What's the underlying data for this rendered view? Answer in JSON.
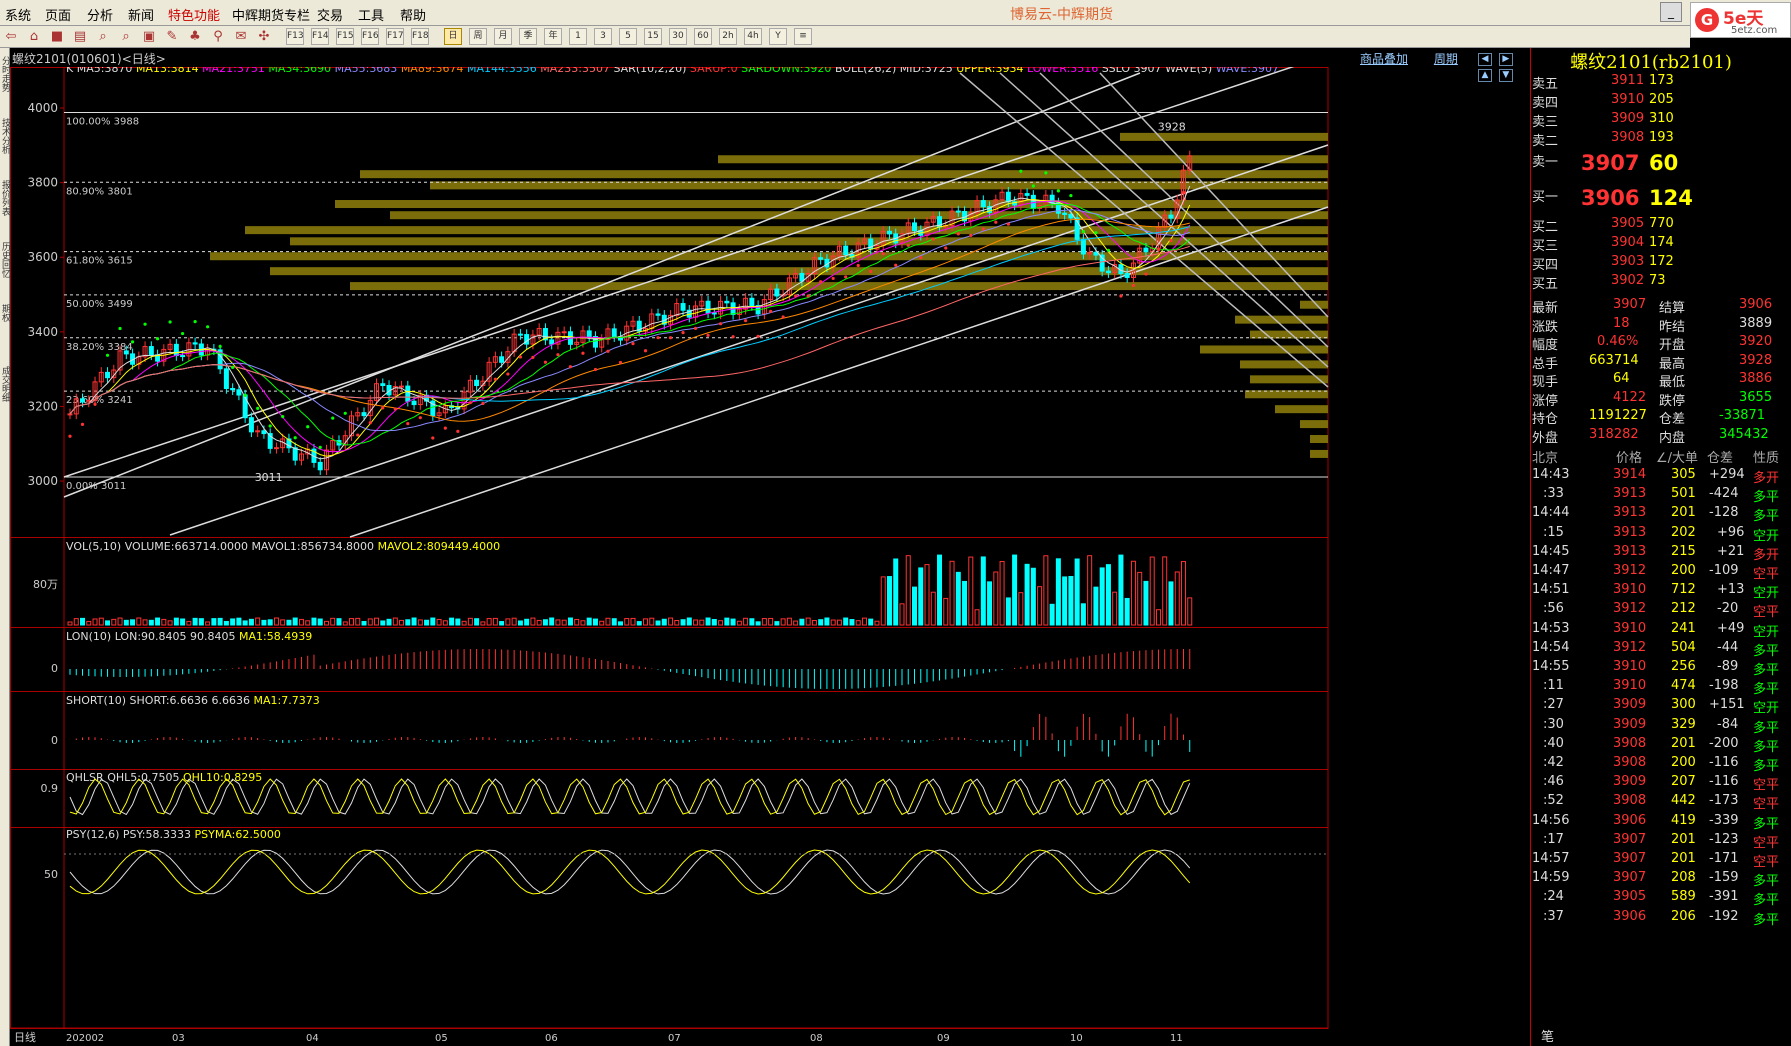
{
  "menu": [
    "系统",
    "页面",
    "分析",
    "新闻",
    "特色功能",
    "中辉期货专栏",
    "交易",
    "工具",
    "帮助"
  ],
  "app_title": "博易云-中辉期货",
  "logo": {
    "brand": "5e天",
    "site": "5etz.com"
  },
  "toolbar": [
    "F1",
    "F2",
    "F3",
    "F4",
    "F5",
    "F6",
    "F7",
    "F8",
    "F9",
    "F10",
    "F11",
    "F12",
    "F13",
    "F14",
    "F15",
    "F16",
    "F17",
    "F18",
    "日",
    "周",
    "月",
    "季",
    "年",
    "1",
    "3",
    "5",
    "15",
    "30",
    "60",
    "2h",
    "4h",
    "Y",
    "≡"
  ],
  "side_tabs": [
    "分时走势",
    "技术分析",
    "报价列表",
    "历史回忆",
    "期权",
    "成交明细"
  ],
  "chart_header": {
    "symbol": "螺纹2101(010601)<日线>",
    "links": [
      "商品叠加",
      "周期"
    ],
    "buttons": [
      "◀",
      "▶",
      "▲",
      "▼"
    ]
  },
  "main_panel": {
    "legend": [
      {
        "t": "K",
        "c": "#ddd"
      },
      {
        "t": "MA5:3870",
        "c": "#ddd"
      },
      {
        "t": "MA13:3814",
        "c": "#ff0"
      },
      {
        "t": "MA21:3751",
        "c": "#f0f"
      },
      {
        "t": "MA34:3690",
        "c": "#0f0"
      },
      {
        "t": "MA55:3683",
        "c": "#88f"
      },
      {
        "t": "MA89:3674",
        "c": "#f80"
      },
      {
        "t": "MA144:3556",
        "c": "#0cf"
      },
      {
        "t": "MA233:3507",
        "c": "#f66"
      },
      {
        "t": "SAR(10,2,20)",
        "c": "#ddd"
      },
      {
        "t": "SARUP:0",
        "c": "#f33"
      },
      {
        "t": "SARDOWN:3920",
        "c": "#0f0"
      },
      {
        "t": "BOLL(26,2)",
        "c": "#ddd"
      },
      {
        "t": "MID:3725",
        "c": "#ddd"
      },
      {
        "t": "UPPER:3934",
        "c": "#ff0"
      },
      {
        "t": "LOWER:3516",
        "c": "#f0f"
      },
      {
        "t": "SSLO",
        "c": "#ddd"
      },
      {
        "t": "3907",
        "c": "#ddd"
      },
      {
        "t": "WAVE(5)",
        "c": "#ddd"
      },
      {
        "t": "WAVE:3907",
        "c": "#88f"
      }
    ],
    "y_ticks": [
      4000,
      3800,
      3600,
      3400,
      3200,
      3000
    ],
    "fib": [
      {
        "label": "100.00% 3988",
        "v": 3988
      },
      {
        "label": "80.90% 3801",
        "v": 3801
      },
      {
        "label": "61.80% 3615",
        "v": 3615
      },
      {
        "label": "50.00% 3499",
        "v": 3499
      },
      {
        "label": "38.20% 3384",
        "v": 3384
      },
      {
        "label": "23.60% 3241",
        "v": 3241
      },
      {
        "label": "0.00% 3011",
        "v": 3011
      }
    ],
    "high_label": "3928",
    "low_label": "3011"
  },
  "vol_panel": {
    "legend": [
      {
        "t": "VOL(5,10) VOLUME:663714.0000",
        "c": "#ddd"
      },
      {
        "t": "MAVOL1:856734.8000",
        "c": "#ddd"
      },
      {
        "t": "MAVOL2:809449.4000",
        "c": "#ff0"
      }
    ],
    "tick": "80万"
  },
  "lon_panel": {
    "legend": [
      {
        "t": "LON(10) LON:90.8405",
        "c": "#ddd"
      },
      {
        "t": "90.8405",
        "c": "#ddd"
      },
      {
        "t": "MA1:58.4939",
        "c": "#ff0"
      }
    ],
    "tick": "0"
  },
  "short_panel": {
    "legend": [
      {
        "t": "SHORT(10) SHORT:6.6636",
        "c": "#ddd"
      },
      {
        "t": "6.6636",
        "c": "#ddd"
      },
      {
        "t": "MA1:7.7373",
        "c": "#ff0"
      }
    ],
    "tick": "0"
  },
  "qhlsr_panel": {
    "legend": [
      {
        "t": "QHLSR",
        "c": "#ddd"
      },
      {
        "t": "QHL5:0.7505",
        "c": "#ddd"
      },
      {
        "t": "QHL10:0.8295",
        "c": "#ff0"
      }
    ],
    "tick": "0.9"
  },
  "psy_panel": {
    "legend": [
      {
        "t": "PSY(12,6)",
        "c": "#ddd"
      },
      {
        "t": "PSY:58.3333",
        "c": "#ddd"
      },
      {
        "t": "PSYMA:62.5000",
        "c": "#ff0"
      }
    ],
    "tick": "50"
  },
  "x_axis": {
    "period": "日线",
    "labels": [
      "202002",
      "03",
      "04",
      "05",
      "06",
      "07",
      "08",
      "09",
      "10",
      "11"
    ]
  },
  "quote": {
    "title": "螺纹2101(rb2101)",
    "asks": [
      {
        "l": "卖五",
        "p": "3911",
        "v": "173"
      },
      {
        "l": "卖四",
        "p": "3910",
        "v": "205"
      },
      {
        "l": "卖三",
        "p": "3909",
        "v": "310"
      },
      {
        "l": "卖二",
        "p": "3908",
        "v": "193"
      },
      {
        "l": "卖一",
        "p": "3907",
        "v": "60"
      }
    ],
    "bids": [
      {
        "l": "买一",
        "p": "3906",
        "v": "124"
      },
      {
        "l": "买二",
        "p": "3905",
        "v": "770"
      },
      {
        "l": "买三",
        "p": "3904",
        "v": "174"
      },
      {
        "l": "买四",
        "p": "3903",
        "v": "172"
      },
      {
        "l": "买五",
        "p": "3902",
        "v": "73"
      }
    ],
    "stats": [
      [
        "最新",
        "3907",
        "red",
        "结算",
        "3906",
        "red"
      ],
      [
        "涨跌",
        "18",
        "red",
        "昨结",
        "3889",
        "wht"
      ],
      [
        "幅度",
        "0.46%",
        "red",
        "开盘",
        "3920",
        "red"
      ],
      [
        "总手",
        "663714",
        "ylw",
        "最高",
        "3928",
        "red"
      ],
      [
        "现手",
        "64",
        "ylw",
        "最低",
        "3886",
        "red"
      ],
      [
        "涨停",
        "4122",
        "red",
        "跌停",
        "3655",
        "grn"
      ],
      [
        "持仓",
        "1191227",
        "ylw",
        "仓差",
        "-33871",
        "grn"
      ],
      [
        "外盘",
        "318282",
        "red",
        "内盘",
        "345432",
        "grn"
      ]
    ],
    "ticks_header": [
      "北京",
      "价格",
      "∠/大单",
      "仓差",
      "性质"
    ],
    "ticks": [
      [
        "14:43",
        "3914",
        "305",
        "+294",
        "多开"
      ],
      [
        ":33",
        "3913",
        "501",
        "-424",
        "多平"
      ],
      [
        "14:44",
        "3913",
        "201",
        "-128",
        "多平"
      ],
      [
        ":15",
        "3913",
        "202",
        "+96",
        "空开"
      ],
      [
        "14:45",
        "3913",
        "215",
        "+21",
        "多开"
      ],
      [
        "14:47",
        "3912",
        "200",
        "-109",
        "空平"
      ],
      [
        "14:51",
        "3910",
        "712",
        "+13",
        "空开"
      ],
      [
        ":56",
        "3912",
        "212",
        "-20",
        "空平"
      ],
      [
        "14:53",
        "3910",
        "241",
        "+49",
        "空开"
      ],
      [
        "14:54",
        "3912",
        "504",
        "-44",
        "多平"
      ],
      [
        "14:55",
        "3910",
        "256",
        "-89",
        "多平"
      ],
      [
        ":11",
        "3910",
        "474",
        "-198",
        "多平"
      ],
      [
        ":27",
        "3909",
        "300",
        "+151",
        "空开"
      ],
      [
        ":30",
        "3909",
        "329",
        "-84",
        "多平"
      ],
      [
        ":40",
        "3908",
        "201",
        "-200",
        "多平"
      ],
      [
        ":42",
        "3908",
        "200",
        "-116",
        "多平"
      ],
      [
        ":46",
        "3909",
        "207",
        "-116",
        "空平"
      ],
      [
        ":52",
        "3908",
        "442",
        "-173",
        "空平"
      ],
      [
        "14:56",
        "3906",
        "419",
        "-339",
        "多平"
      ],
      [
        ":17",
        "3907",
        "201",
        "-123",
        "空平"
      ],
      [
        "14:57",
        "3907",
        "201",
        "-171",
        "空平"
      ],
      [
        "14:59",
        "3907",
        "208",
        "-159",
        "多平"
      ],
      [
        ":24",
        "3905",
        "589",
        "-391",
        "多平"
      ],
      [
        ":37",
        "3906",
        "206",
        "-192",
        "多平"
      ]
    ],
    "footer": "笔"
  }
}
